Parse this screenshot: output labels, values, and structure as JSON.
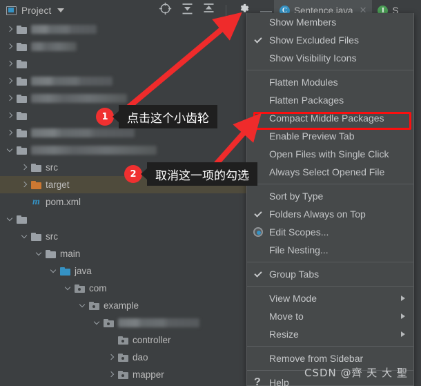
{
  "toolbar": {
    "project_label": "Project",
    "project_icon": "project-panel-icon",
    "dropdown_icon": "chevron-down-icon",
    "icons": [
      {
        "name": "locate-target-icon",
        "title": "Select Opened File"
      },
      {
        "name": "expand-all-icon",
        "title": "Expand All"
      },
      {
        "name": "collapse-all-icon",
        "title": "Collapse All"
      },
      {
        "name": "gear-icon",
        "title": "Settings"
      },
      {
        "name": "minimize-icon",
        "title": "Hide"
      }
    ],
    "minimize_glyph": "—"
  },
  "tabs": [
    {
      "label": "Sentence.java",
      "icon": "java-class-icon",
      "icon_letter": "C",
      "icon_color": "#3592c4",
      "active": true,
      "close_glyph": "✕"
    },
    {
      "label": "S",
      "icon": "java-interface-icon",
      "icon_letter": "I",
      "icon_color": "#499c54",
      "active": false
    }
  ],
  "tree": {
    "rows": [
      {
        "indent": 0,
        "arrow": "right",
        "icon": "folder-module",
        "color": "grey",
        "label": "",
        "redacted": true,
        "blur_width": 95,
        "blur_class": "bl1"
      },
      {
        "indent": 0,
        "arrow": "right",
        "icon": "folder-module",
        "color": "grey",
        "label": "",
        "redacted": true,
        "blur_width": 66,
        "blur_class": "bl2"
      },
      {
        "indent": 0,
        "arrow": "right",
        "icon": "folder-module",
        "color": "grey",
        "label": "",
        "redacted": true,
        "blur_width": 160,
        "blur_class": "bl3"
      },
      {
        "indent": 0,
        "arrow": "right",
        "icon": "folder-module",
        "color": "grey",
        "label": "",
        "redacted": true,
        "blur_width": 118,
        "blur_class": "bl1"
      },
      {
        "indent": 0,
        "arrow": "right",
        "icon": "folder-module",
        "color": "grey",
        "label": "",
        "redacted": true,
        "blur_width": 139,
        "blur_class": "bl2"
      },
      {
        "indent": 0,
        "arrow": "right",
        "icon": "folder-module",
        "color": "grey",
        "label": "",
        "redacted": true,
        "blur_width": 176,
        "blur_class": "bl3"
      },
      {
        "indent": 0,
        "arrow": "right",
        "icon": "folder-module",
        "color": "grey",
        "label": "",
        "redacted": true,
        "blur_width": 150,
        "blur_class": "bl1"
      },
      {
        "indent": 0,
        "arrow": "down",
        "icon": "folder-module",
        "color": "grey",
        "label": "",
        "redacted": true,
        "blur_width": 182,
        "blur_class": "bl2"
      },
      {
        "indent": 1,
        "arrow": "right",
        "icon": "folder",
        "color": "grey",
        "label": "src",
        "redacted": false
      },
      {
        "indent": 1,
        "arrow": "right",
        "icon": "folder",
        "color": "orange",
        "label": "target",
        "redacted": false,
        "selected": true
      },
      {
        "indent": 1,
        "arrow": "none",
        "icon": "maven-file",
        "color": "blue",
        "label": "pom.xml",
        "redacted": false
      },
      {
        "indent": 0,
        "arrow": "down",
        "icon": "folder-module",
        "color": "grey",
        "label": "",
        "redacted": true,
        "blur_width": 196,
        "blur_class": "bl3"
      },
      {
        "indent": 1,
        "arrow": "down",
        "icon": "folder",
        "color": "grey",
        "label": "src",
        "redacted": false
      },
      {
        "indent": 2,
        "arrow": "down",
        "icon": "folder",
        "color": "grey",
        "label": "main",
        "redacted": false
      },
      {
        "indent": 3,
        "arrow": "down",
        "icon": "folder",
        "color": "blue",
        "label": "java",
        "redacted": false
      },
      {
        "indent": 4,
        "arrow": "down",
        "icon": "package",
        "color": "pkg",
        "label": "com",
        "redacted": false
      },
      {
        "indent": 5,
        "arrow": "down",
        "icon": "package",
        "color": "pkg",
        "label": "example",
        "redacted": false
      },
      {
        "indent": 6,
        "arrow": "down",
        "icon": "package",
        "color": "pkg",
        "label": "",
        "redacted": true,
        "blur_width": 118,
        "blur_class": "bl1"
      },
      {
        "indent": 7,
        "arrow": "none",
        "icon": "package",
        "color": "pkg",
        "label": "controller",
        "redacted": false
      },
      {
        "indent": 7,
        "arrow": "right",
        "icon": "package",
        "color": "pkg",
        "label": "dao",
        "redacted": false
      },
      {
        "indent": 7,
        "arrow": "right",
        "icon": "package",
        "color": "pkg",
        "label": "mapper",
        "redacted": false
      }
    ]
  },
  "menu": {
    "items": [
      {
        "label": "Show Members",
        "mark": "none",
        "submenu": false
      },
      {
        "label": "Show Excluded Files",
        "mark": "check",
        "submenu": false
      },
      {
        "label": "Show Visibility Icons",
        "mark": "none",
        "submenu": false
      },
      {
        "separator": true
      },
      {
        "label": "Flatten Modules",
        "mark": "none",
        "submenu": false
      },
      {
        "label": "Flatten Packages",
        "mark": "none",
        "submenu": false
      },
      {
        "label": "Compact Middle Packages",
        "mark": "none",
        "submenu": false,
        "highlighted": true
      },
      {
        "label": "Enable Preview Tab",
        "mark": "none",
        "submenu": false
      },
      {
        "label": "Open Files with Single Click",
        "mark": "none",
        "submenu": false
      },
      {
        "label": "Always Select Opened File",
        "mark": "none",
        "submenu": false
      },
      {
        "separator": true
      },
      {
        "label": "Sort by Type",
        "mark": "none",
        "submenu": false
      },
      {
        "label": "Folders Always on Top",
        "mark": "check",
        "submenu": false
      },
      {
        "label": "Edit Scopes...",
        "mark": "radio",
        "submenu": false
      },
      {
        "label": "File Nesting...",
        "mark": "none",
        "submenu": false
      },
      {
        "separator": true
      },
      {
        "label": "Group Tabs",
        "mark": "check",
        "submenu": false
      },
      {
        "separator": true
      },
      {
        "label": "View Mode",
        "mark": "none",
        "submenu": true
      },
      {
        "label": "Move to",
        "mark": "none",
        "submenu": true
      },
      {
        "label": "Resize",
        "mark": "none",
        "submenu": true
      },
      {
        "separator": true
      },
      {
        "label": "Remove from Sidebar",
        "mark": "none",
        "submenu": false
      },
      {
        "separator": true
      },
      {
        "label": "Help",
        "mark": "qmark",
        "submenu": false
      }
    ]
  },
  "annotations": {
    "callout1": {
      "number": "1",
      "text": "点击这个小齿轮"
    },
    "callout2": {
      "number": "2",
      "text": "取消这一项的勾选"
    },
    "highlight_color": "#fb0f0f",
    "arrow_color": "#ef2b2b"
  },
  "watermark": {
    "text": "CSDN @齊 天 大 聖"
  }
}
